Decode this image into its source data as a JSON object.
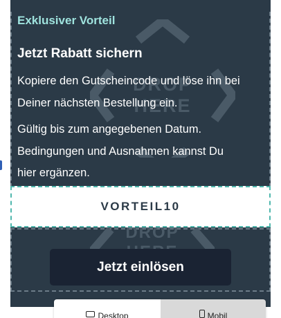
{
  "voucher": {
    "badge": "Exklusiver Vorteil",
    "headline": "Jetzt Rabatt sichern",
    "body_1": {
      "line_1": "Kopiere den Gutscheincode und löse ihn bei",
      "line_2": "Deiner nächsten Bestellung ein."
    },
    "body_2": {
      "line_1": "Gültig bis zum angegebenen Datum.",
      "line_2": "Bedingungen und Ausnahmen kannst Du",
      "line_3": "hier ergänzen."
    },
    "code": "VORTEIL10",
    "cta_label": "Jetzt einlösen",
    "watermark_text": {
      "line_1": "DROP",
      "line_2": "HERE"
    },
    "colors": {
      "background": "#2b3a47",
      "accent_text": "#9fe3de",
      "code_border": "#4fb7ad",
      "cta_background": "#1a2333"
    }
  },
  "device_switcher": {
    "desktop_label": "Desktop",
    "desktop_icon": "desktop-icon",
    "mobile_label": "Mobil",
    "mobile_icon": "mobile-icon",
    "active": "mobile"
  }
}
